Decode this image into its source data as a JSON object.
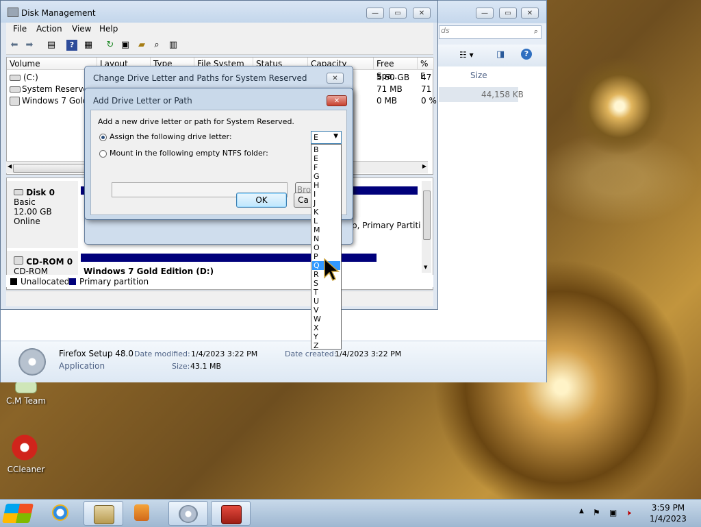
{
  "desktop": {
    "icons": [
      {
        "label": "C.M Team"
      },
      {
        "label": "CCleaner"
      }
    ]
  },
  "explorer": {
    "search_placeholder": "ds",
    "column_size": "Size",
    "file_size_value": "44,158 KB",
    "details": {
      "name": "Firefox Setup 48.0",
      "type": "Application",
      "date_modified_label": "Date modified:",
      "date_modified": "1/4/2023 3:22 PM",
      "date_created_label": "Date created:",
      "date_created": "1/4/2023 3:22 PM",
      "size_label": "Size:",
      "size": "43.1 MB"
    }
  },
  "diskmgmt": {
    "title": "Disk Management",
    "menu": [
      "File",
      "Action",
      "View",
      "Help"
    ],
    "columns": [
      "Volume",
      "Layout",
      "Type",
      "File System",
      "Status",
      "Capacity",
      "Free Spa...",
      "% F"
    ],
    "volumes": [
      {
        "name": "(C:)",
        "free": "5.60 GB",
        "pct": "47"
      },
      {
        "name": "System Reserved",
        "free": "71 MB",
        "pct": "71"
      },
      {
        "name": "Windows 7 Gold E",
        "free": "0 MB",
        "pct": "0 %"
      }
    ],
    "disks": [
      {
        "name": "Disk 0",
        "kind": "Basic",
        "size": "12.00 GB",
        "state": "Online"
      },
      {
        "name": "CD-ROM 0",
        "kind": "CD-ROM"
      }
    ],
    "partition_hint": "p, Primary Partiti",
    "cd_partition_label": "Windows 7 Gold Edition  (D:)",
    "legend": {
      "unallocated": "Unallocated",
      "primary": "Primary partition"
    },
    "colors": {
      "primary": "#00007b",
      "unallocated": "#000000"
    },
    "bg_ok": "OK",
    "bg_cancel": "Ca"
  },
  "dialog_change": {
    "title": "Change Drive Letter and Paths for System Reserved",
    "ok_label": "OK",
    "cancel_label": "Ca"
  },
  "dialog_add": {
    "title": "Add Drive Letter or Path",
    "description": "Add a new drive letter or path for System Reserved.",
    "assign_label": "Assign the following drive letter:",
    "mount_label": "Mount in the following empty NTFS folder:",
    "browse_label": "Bro",
    "ok_label": "OK",
    "cancel_label": "Ca",
    "selected_letter": "E",
    "letters": [
      "B",
      "E",
      "F",
      "G",
      "H",
      "I",
      "J",
      "K",
      "L",
      "M",
      "N",
      "O",
      "P",
      "Q",
      "R",
      "S",
      "T",
      "U",
      "V",
      "W",
      "X",
      "Y",
      "Z"
    ],
    "highlighted_letter": "Q"
  },
  "taskbar": {
    "time": "3:59 PM",
    "date": "1/4/2023"
  }
}
